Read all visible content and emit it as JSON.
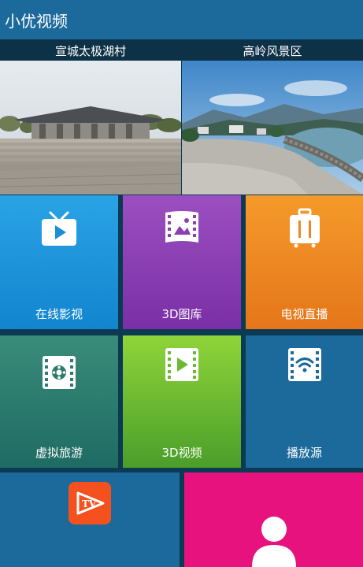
{
  "app": {
    "title": "小优视频"
  },
  "places": [
    {
      "label": "宣城太极湖村"
    },
    {
      "label": "高岭风景区"
    }
  ],
  "tiles": [
    {
      "label": "在线影视",
      "icon": "tv-play-icon"
    },
    {
      "label": "3D图库",
      "icon": "film-gallery-icon"
    },
    {
      "label": "电视直播",
      "icon": "suitcase-tv-icon"
    },
    {
      "label": "虚拟旅游",
      "icon": "film-globe-icon"
    },
    {
      "label": "3D视频",
      "icon": "film-play-icon"
    },
    {
      "label": "播放源",
      "icon": "film-wifi-icon"
    },
    {
      "label": "",
      "icon": "tv-logo-icon"
    },
    {
      "label": "",
      "icon": "user-icon"
    }
  ],
  "colors": {
    "app_bar": "#1c6a9c",
    "place_bar": "#0d3147",
    "tile_online": "#1a8fd8",
    "tile_gallery": "#8a3fb3",
    "tile_live": "#ee8722",
    "tile_vr": "#2b7c6e",
    "tile_3dvideo": "#6cba32",
    "tile_source": "#1c6a9c",
    "tile_user": "#e7127e",
    "tv_logo": "#f4511e"
  }
}
